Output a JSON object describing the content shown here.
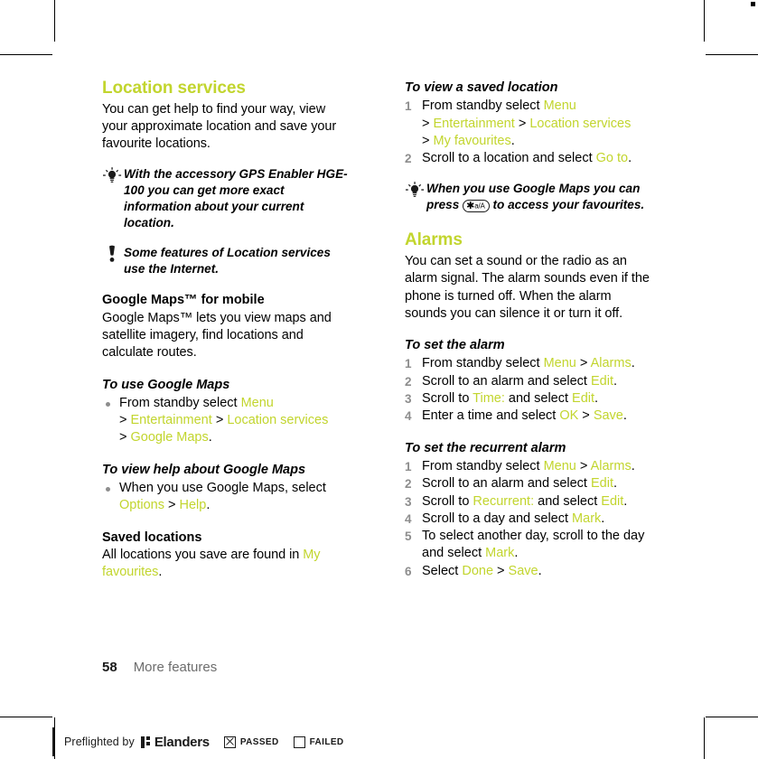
{
  "document": {
    "page_number": "58",
    "chapter": "More features"
  },
  "left_column": {
    "section_title": "Location services",
    "intro": "You can get help to find your way, view your approximate location and save your favourite locations.",
    "tip_callout": {
      "icon": "lightbulb-icon",
      "text": "With the accessory GPS Enabler HGE-100 you can get more exact information about your current location."
    },
    "note_callout": {
      "icon": "exclamation-icon",
      "text": "Some features of Location services use the Internet."
    },
    "maps_heading": "Google Maps™ for mobile",
    "maps_body": "Google Maps™ lets you view maps and satellite imagery, find locations and calculate routes.",
    "task_use_maps": {
      "title": "To use Google Maps",
      "step_prefix": "From standby select ",
      "menu": "Menu",
      "path2": "Entertainment",
      "path3": "Location services",
      "path4": "Google Maps",
      "gt": ">",
      "period": "."
    },
    "task_help_maps": {
      "title": "To view help about Google Maps",
      "step_prefix": "When you use Google Maps, select ",
      "options": "Options",
      "gt": ">",
      "help": "Help",
      "period": "."
    },
    "saved_heading": "Saved locations",
    "saved_body_prefix": "All locations you save are found in ",
    "saved_body_link": "My favourites",
    "saved_body_suffix": "."
  },
  "right_column": {
    "task_view_saved": {
      "title": "To view a saved location",
      "s1_prefix": "From standby select ",
      "s1_menu": "Menu",
      "s1_p2": "Entertainment",
      "s1_p3": "Location services",
      "s1_p4": "My favourites",
      "s2_prefix": "Scroll to a location and select ",
      "s2_link": "Go to",
      "gt": ">",
      "period": "."
    },
    "tip_callout": {
      "icon": "lightbulb-icon",
      "text_before": "When you use Google Maps you can press ",
      "key_star": "✱",
      "key_label": "a/A",
      "text_after": " to access your favourites."
    },
    "alarms_title": "Alarms",
    "alarms_intro": "You can set a sound or the radio as an alarm signal. The alarm sounds even if the phone is turned off. When the alarm sounds you can silence it or turn it off.",
    "task_set_alarm": {
      "title": "To set the alarm",
      "steps": [
        {
          "pre": "From standby select ",
          "l1": "Menu",
          "gt": " > ",
          "l2": "Alarms",
          "post": "."
        },
        {
          "pre": "Scroll to an alarm and select ",
          "l1": "Edit",
          "gt": "",
          "l2": "",
          "post": "."
        },
        {
          "pre": "Scroll to ",
          "l1": "Time:",
          "mid": " and select ",
          "l2": "Edit",
          "post": "."
        },
        {
          "pre": "Enter a time and select ",
          "l1": "OK",
          "gt": " > ",
          "l2": "Save",
          "post": "."
        }
      ]
    },
    "task_recurrent_alarm": {
      "title": "To set the recurrent alarm",
      "steps": [
        {
          "pre": "From standby select ",
          "l1": "Menu",
          "gt": " > ",
          "l2": "Alarms",
          "post": "."
        },
        {
          "pre": "Scroll to an alarm and select ",
          "l1": "Edit",
          "post": "."
        },
        {
          "pre": "Scroll to ",
          "l1": "Recurrent:",
          "mid": " and select ",
          "l2": "Edit",
          "post": "."
        },
        {
          "pre": "Scroll to a day and select ",
          "l1": "Mark",
          "post": "."
        },
        {
          "pre": "To select another day, scroll to the day and select ",
          "l1": "Mark",
          "post": "."
        },
        {
          "pre": "Select ",
          "l1": "Done",
          "gt": " > ",
          "l2": "Save",
          "post": "."
        }
      ]
    }
  },
  "preflight": {
    "label": "Preflighted by",
    "brand": "Elanders",
    "passed_label": "PASSED",
    "failed_label": "FAILED",
    "passed_checked": true,
    "failed_checked": false
  },
  "colors": {
    "accent_green": "#c2d52e",
    "marker_gray": "#8d8d8d",
    "chapter_gray": "#6d6d6d"
  }
}
